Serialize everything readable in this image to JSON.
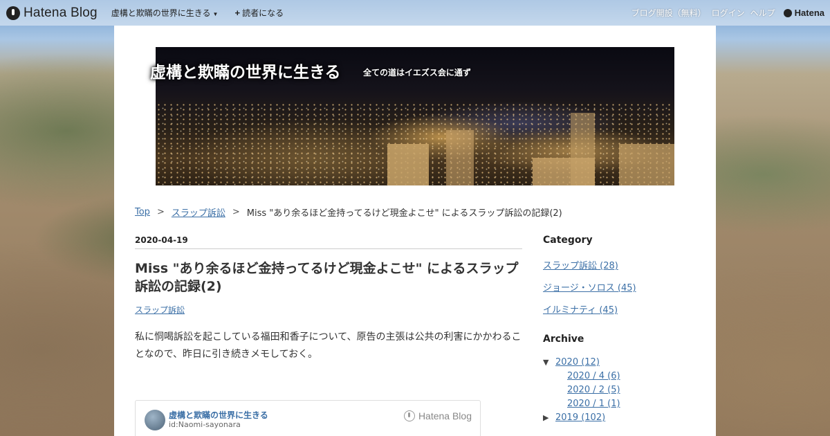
{
  "topbar": {
    "brand": "Hatena Blog",
    "blog_name": "虚構と欺瞞の世界に生きる",
    "subscribe": "読者になる",
    "right_links": [
      "ブログ開設（無料）",
      "ログイン",
      "ヘルプ"
    ],
    "hatena": "Hatena"
  },
  "header": {
    "title": "虚構と欺瞞の世界に生きる",
    "description": "全ての道はイエズス会に通ず"
  },
  "breadcrumb": {
    "top": "Top",
    "sep": ">",
    "category": "スラップ訴訟",
    "current": "Miss \"あり余るほど金持ってるけど現金よこせ\" によるスラップ訴訟の記録(2)"
  },
  "entry": {
    "date": "2020-04-19",
    "title": "Miss \"あり余るほど金持ってるけど現金よこせ\" によるスラップ訴訟の記録(2)",
    "category": "スラップ訴訟",
    "body": "私に恫喝訴訟を起こしている福田和香子について、原告の主張は公共の利害にかかわることなので、昨日に引き続きメモしておく。"
  },
  "embed": {
    "blog_name": "虚構と欺瞞の世界に生きる",
    "id": "id:Naomi-sayonara",
    "brand": "Hatena Blog"
  },
  "sidebar": {
    "category_heading": "Category",
    "categories": [
      {
        "label": "スラップ訴訟 (28)"
      },
      {
        "label": "ジョージ・ソロス (45)"
      },
      {
        "label": "イルミナティ (45)"
      }
    ],
    "archive_heading": "Archive",
    "archive": {
      "year_2020": "2020 (12)",
      "months": [
        "2020 / 4 (6)",
        "2020 / 2 (5)",
        "2020 / 1 (1)"
      ],
      "year_2019": "2019 (102)"
    }
  }
}
